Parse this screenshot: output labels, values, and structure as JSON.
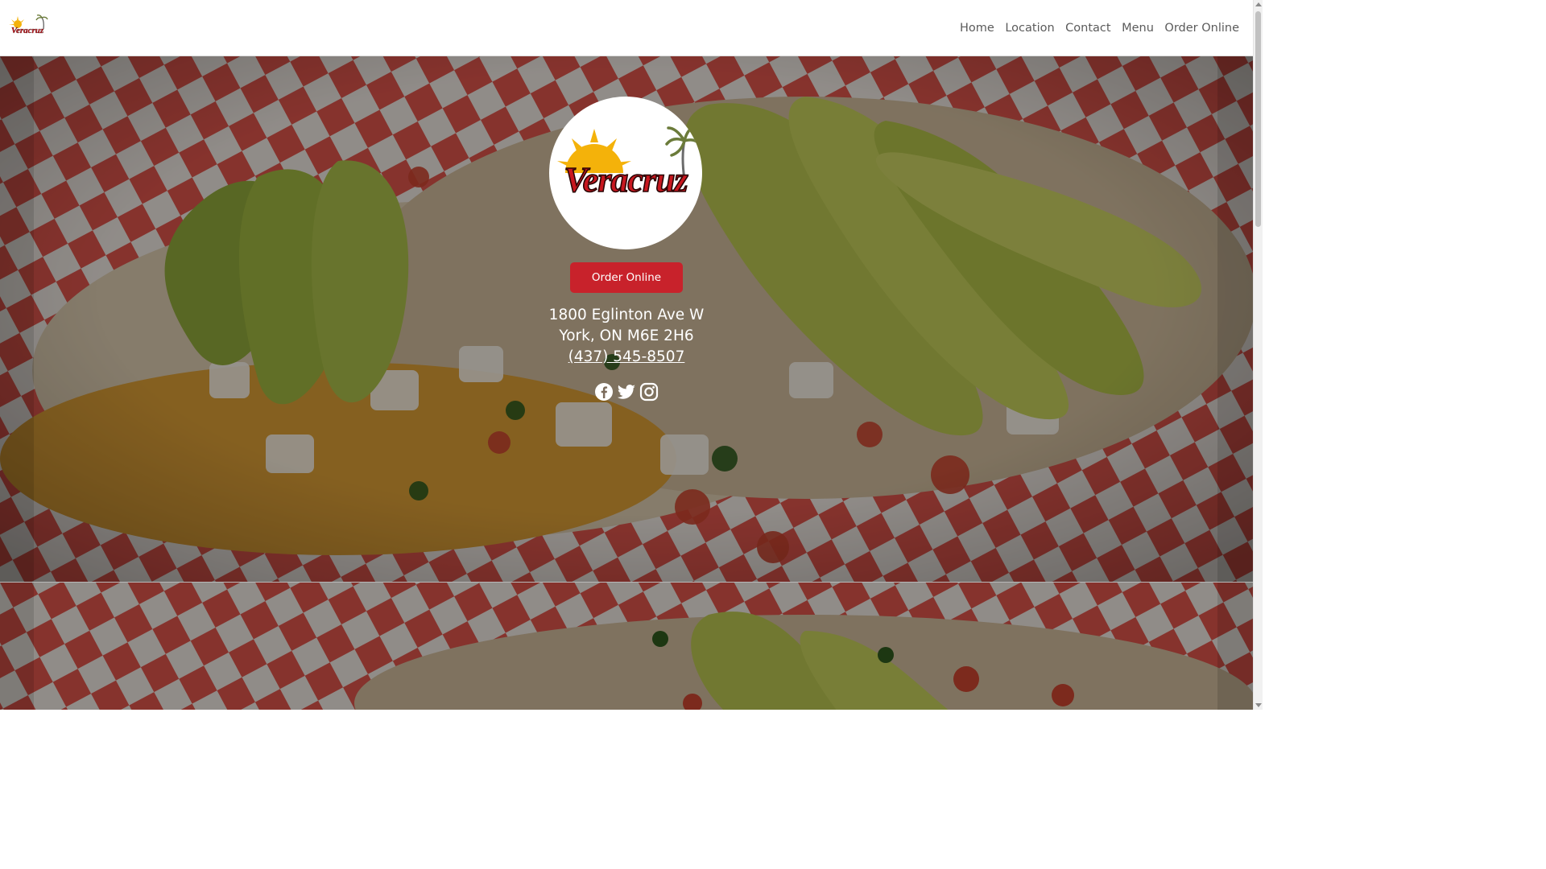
{
  "nav": {
    "logo_text": "Veracruz",
    "links": [
      {
        "label": "Home"
      },
      {
        "label": "Location"
      },
      {
        "label": "Contact"
      },
      {
        "label": "Menu"
      },
      {
        "label": "Order Online"
      }
    ]
  },
  "hero": {
    "logo_text": "Veracruz",
    "order_button": "Order Online",
    "address_line1": "1800 Eglinton Ave W",
    "address_line2": "York, ON M6E 2H6",
    "phone": "(437) 545-8507",
    "socials": [
      {
        "icon": "facebook-icon"
      },
      {
        "icon": "twitter-icon"
      },
      {
        "icon": "instagram-icon"
      }
    ]
  },
  "colors": {
    "brand_red": "#c8222b",
    "logo_text_red": "#c8171f",
    "sun_yellow": "#f4b20a",
    "nav_text": "#5b5b5b"
  }
}
